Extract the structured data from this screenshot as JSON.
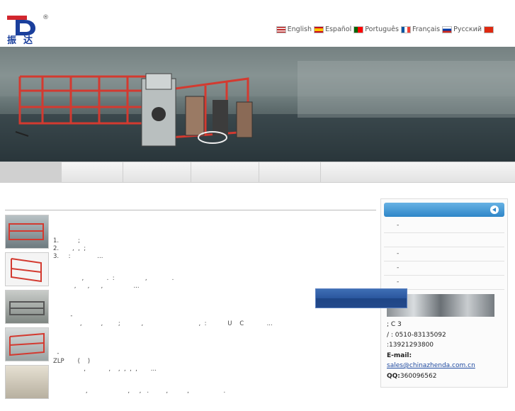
{
  "header": {
    "logo": {
      "reg_mark": "®",
      "cn_name": "振达"
    },
    "languages": [
      {
        "label": "English",
        "flag": "us"
      },
      {
        "label": "Español",
        "flag": "es"
      },
      {
        "label": "Português",
        "flag": "pt"
      },
      {
        "label": "Français",
        "flag": "fr"
      },
      {
        "label": "Русский",
        "flag": "ru"
      },
      {
        "label": "",
        "flag": "cn"
      }
    ]
  },
  "nav": {
    "items": [
      "",
      "",
      "",
      "",
      ""
    ]
  },
  "products": [
    {
      "lines": [
        "1.          ;",
        "2.       ,  ,  ;",
        "3.     :              ..."
      ]
    },
    {
      "lines": [
        "",
        "               ,            .  :                ,             .",
        "           ,      ,      ,                ..."
      ]
    },
    {
      "lines": [
        "         -",
        "              ,          ,        ;           ,                             ,  :           U    C            ..."
      ]
    },
    {
      "lines": [
        "  -",
        "ZLP       (    )",
        "                ,            ,    ,  ,  ,  ,       ..."
      ]
    },
    {
      "lines": [
        "",
        "                 ,                     ,     ,   .         ,          ,                  ."
      ]
    }
  ],
  "sidebar": {
    "rows": [
      "-",
      "",
      "-",
      "-",
      "-"
    ],
    "contact": {
      "address": "  ;          C 3",
      "phone": "   /   :  0510-83135092",
      "mobile": "  :13921293800",
      "email_label": "E-mail:",
      "email": "sales@chinazhenda.com.cn",
      "qq_label": "QQ:",
      "qq": "360096562"
    }
  },
  "colors": {
    "sidebar_head": "#2f86c8",
    "logo_red": "#d2262e",
    "logo_blue": "#1a3f9c",
    "banner_red": "#d33a30"
  }
}
